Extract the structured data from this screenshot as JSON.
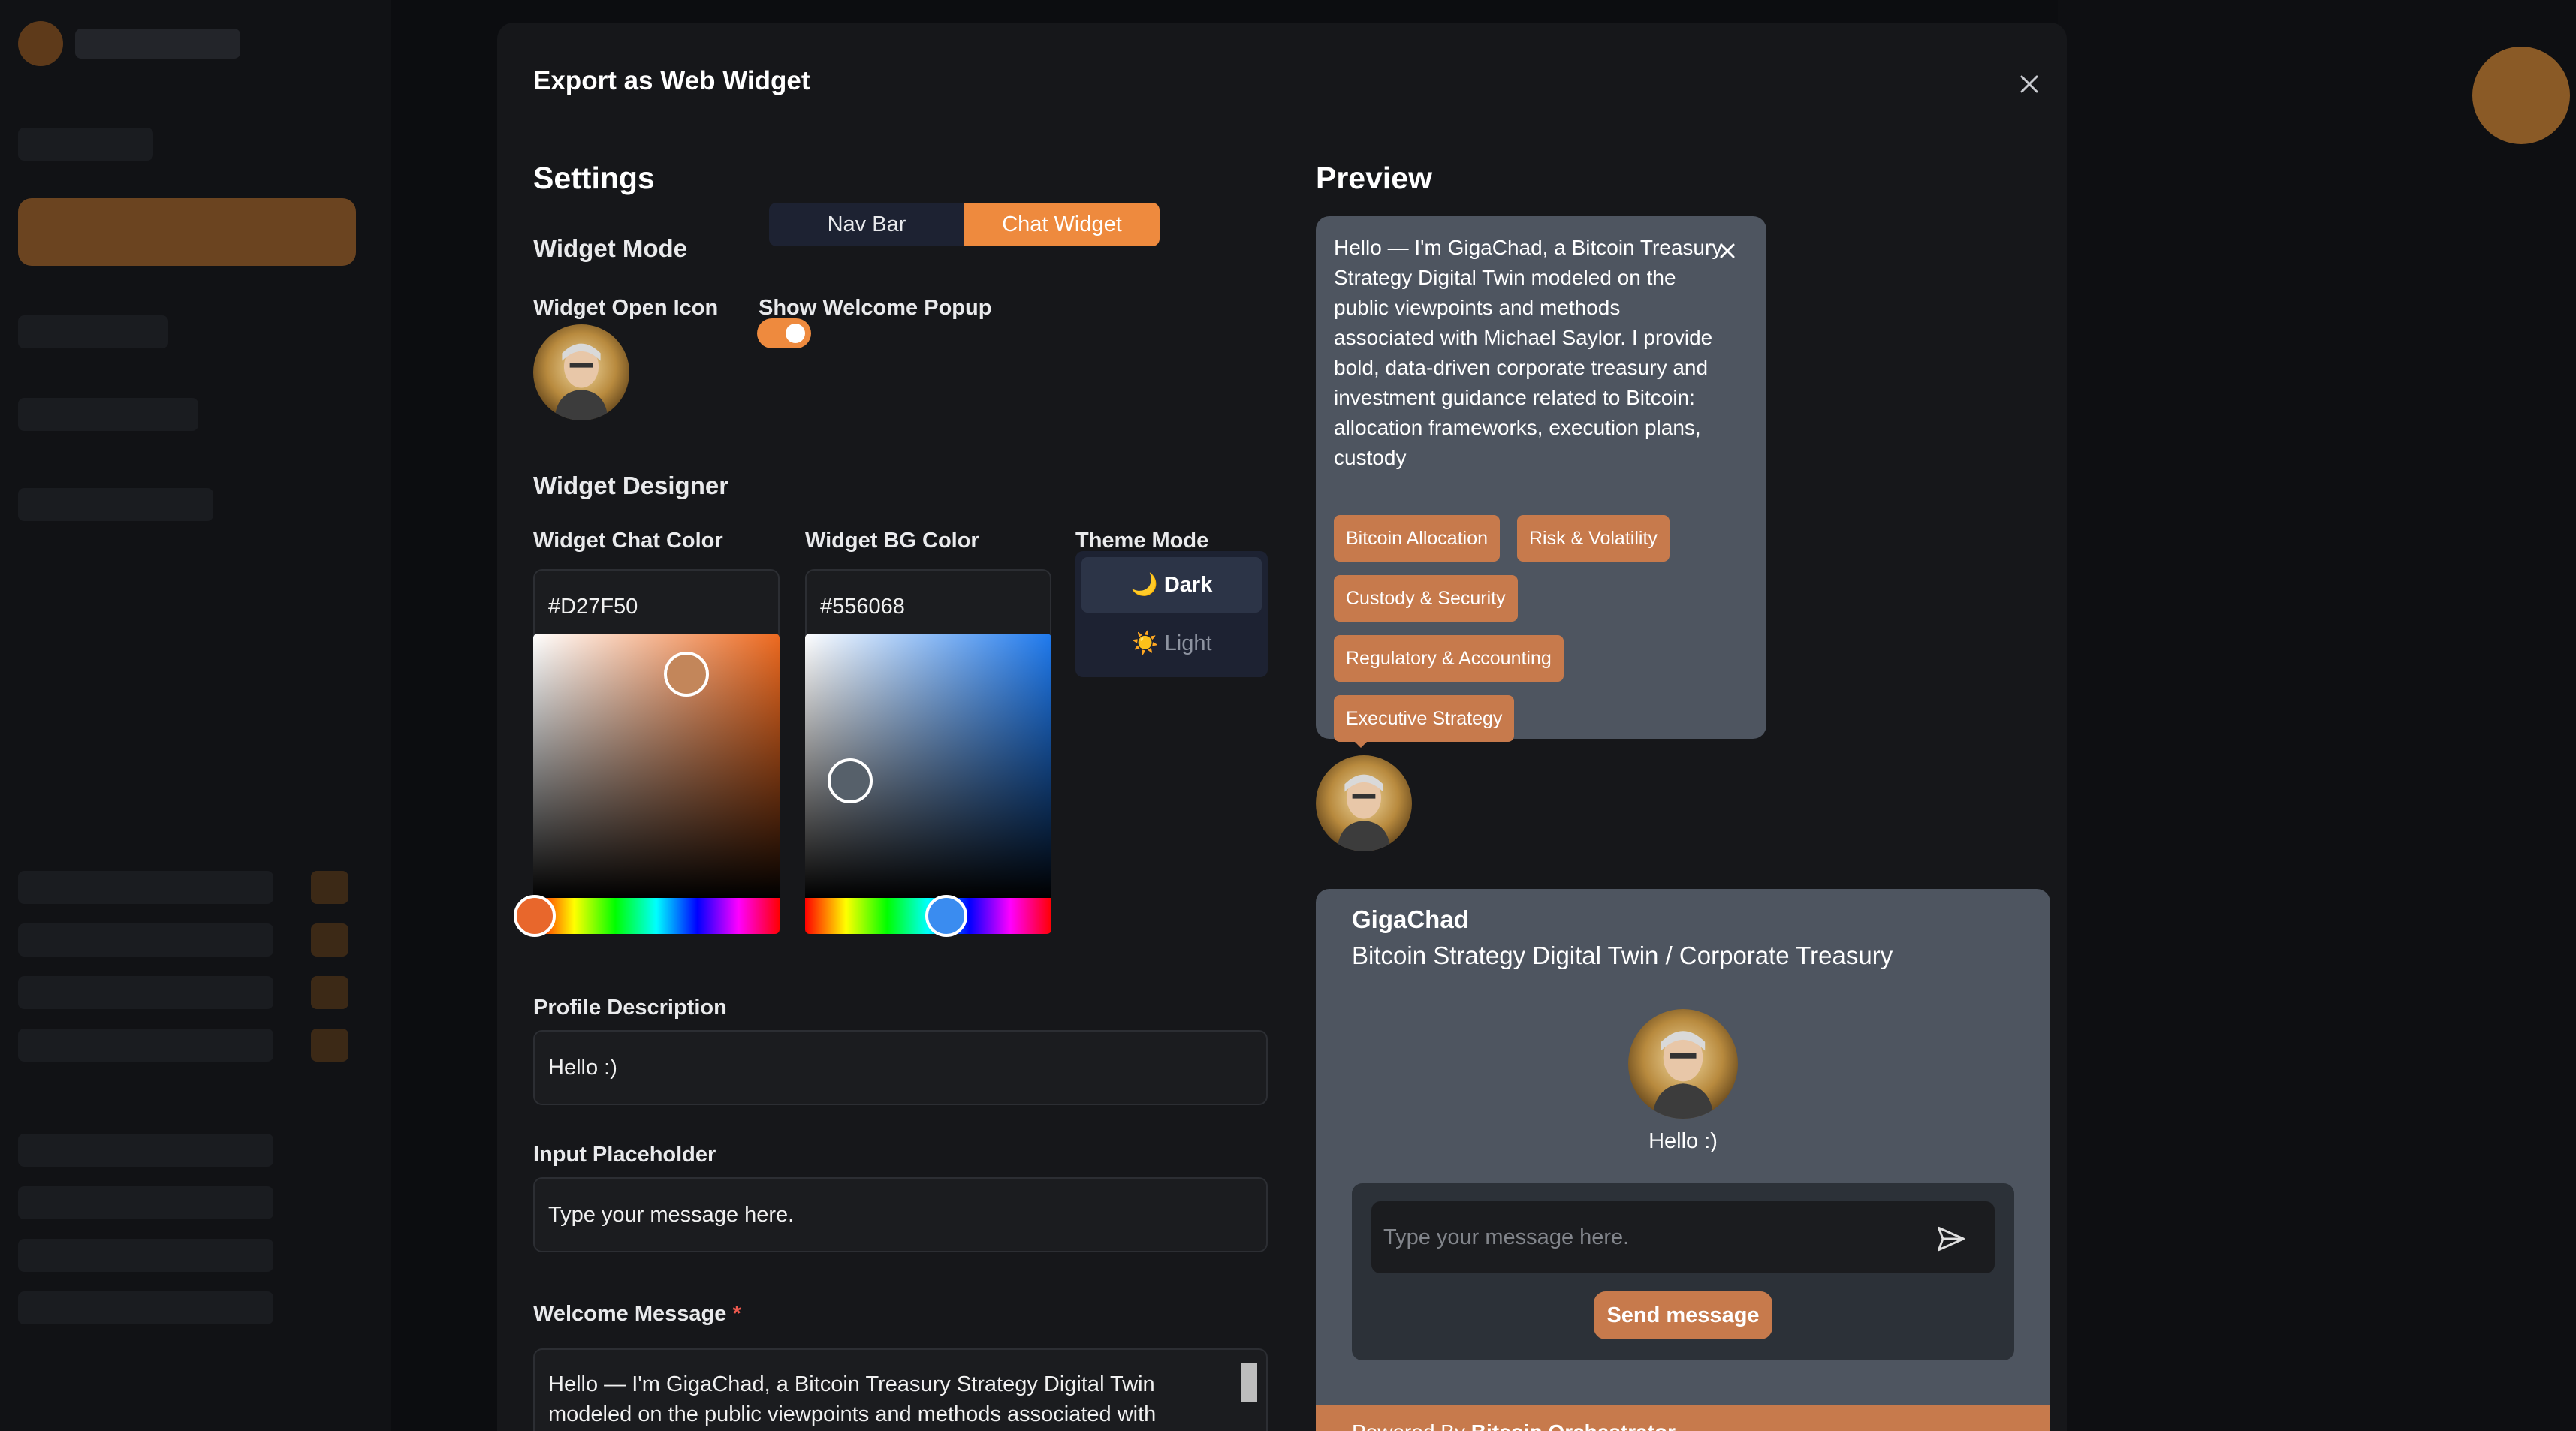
{
  "modal": {
    "title": "Export as Web Widget"
  },
  "settings": {
    "title": "Settings",
    "widget_mode_label": "Widget Mode",
    "mode_options": [
      "Nav Bar",
      "Chat Widget"
    ],
    "mode_selected": "Chat Widget",
    "open_icon_label": "Widget Open Icon",
    "welcome_popup_label": "Show Welcome Popup",
    "welcome_popup_on": true,
    "designer_title": "Widget Designer",
    "chat_color_label": "Widget Chat Color",
    "chat_color_value": "#D27F50",
    "bg_color_label": "Widget BG Color",
    "bg_color_value": "#556068",
    "theme_label": "Theme Mode",
    "theme_dark": "🌙 Dark",
    "theme_light": "☀️ Light",
    "theme_selected": "Dark",
    "profile_description_label": "Profile Description",
    "profile_description_value": "Hello :)",
    "input_placeholder_label": "Input Placeholder",
    "input_placeholder_value": "Type your message here.",
    "welcome_message_label": "Welcome Message",
    "welcome_message_required": "*",
    "welcome_message_line1": "Hello — I'm GigaChad, a Bitcoin Treasury Strategy Digital Twin",
    "welcome_message_line2": "modeled on the public viewpoints and methods associated with"
  },
  "preview": {
    "title": "Preview",
    "popup_text": "Hello — I'm GigaChad, a Bitcoin Treasury Strategy Digital Twin modeled on the public viewpoints and methods associated with Michael Saylor. I provide bold, data-driven corporate treasury and investment guidance related to Bitcoin: allocation frameworks, execution plans, custody",
    "chips": [
      "Bitcoin Allocation",
      "Risk & Volatility",
      "Custody & Security",
      "Regulatory & Accounting",
      "Executive Strategy"
    ],
    "chat_name": "GigaChad",
    "chat_subtitle": "Bitcoin Strategy Digital Twin / Corporate Treasury",
    "chat_greeting": "Hello :)",
    "chat_input_placeholder": "Type your message here.",
    "send_button": "Send message",
    "powered_prefix": "Powered By",
    "powered_brand": "Bitcoin Orchestrator"
  },
  "colors": {
    "accent": "#EE8A3E",
    "chat": "#D27F50",
    "bg": "#556068",
    "modal": "#16171A"
  },
  "icons": [
    "close-icon",
    "send-icon",
    "avatar"
  ]
}
